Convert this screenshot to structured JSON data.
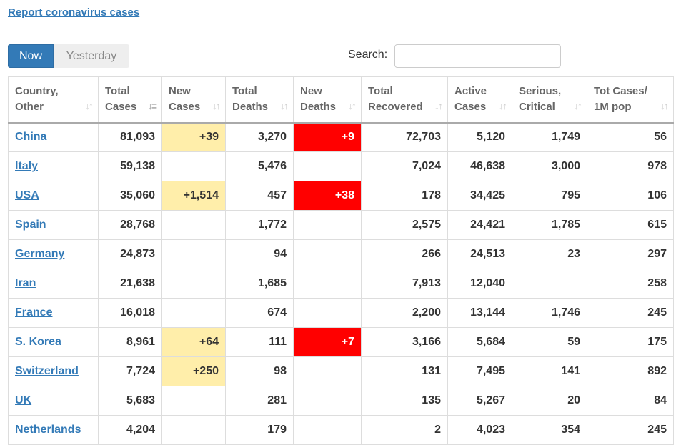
{
  "report_link": "Report coronavirus cases",
  "tabs": {
    "now": "Now",
    "yesterday": "Yesterday"
  },
  "search": {
    "label": "Search:",
    "value": ""
  },
  "colors": {
    "link": "#337ab7",
    "new_cases_highlight": "#ffeeaa",
    "new_deaths_highlight": "#ff0000"
  },
  "icons": {
    "sort_inactive": "sort-icon",
    "sort_active": "sort-desc-icon"
  },
  "columns": [
    {
      "line1": "Country,",
      "line2": "Other"
    },
    {
      "line1": "Total",
      "line2": "Cases"
    },
    {
      "line1": "New",
      "line2": "Cases"
    },
    {
      "line1": "Total",
      "line2": "Deaths"
    },
    {
      "line1": "New",
      "line2": "Deaths"
    },
    {
      "line1": "Total",
      "line2": "Recovered"
    },
    {
      "line1": "Active",
      "line2": "Cases"
    },
    {
      "line1": "Serious,",
      "line2": "Critical"
    },
    {
      "line1": "Tot Cases/",
      "line2": "1M pop"
    }
  ],
  "rows": [
    {
      "country": "China",
      "total_cases": "81,093",
      "new_cases": "+39",
      "total_deaths": "3,270",
      "new_deaths": "+9",
      "total_recovered": "72,703",
      "active_cases": "5,120",
      "serious_critical": "1,749",
      "per_million": "56"
    },
    {
      "country": "Italy",
      "total_cases": "59,138",
      "new_cases": "",
      "total_deaths": "5,476",
      "new_deaths": "",
      "total_recovered": "7,024",
      "active_cases": "46,638",
      "serious_critical": "3,000",
      "per_million": "978"
    },
    {
      "country": "USA",
      "total_cases": "35,060",
      "new_cases": "+1,514",
      "total_deaths": "457",
      "new_deaths": "+38",
      "total_recovered": "178",
      "active_cases": "34,425",
      "serious_critical": "795",
      "per_million": "106"
    },
    {
      "country": "Spain",
      "total_cases": "28,768",
      "new_cases": "",
      "total_deaths": "1,772",
      "new_deaths": "",
      "total_recovered": "2,575",
      "active_cases": "24,421",
      "serious_critical": "1,785",
      "per_million": "615"
    },
    {
      "country": "Germany",
      "total_cases": "24,873",
      "new_cases": "",
      "total_deaths": "94",
      "new_deaths": "",
      "total_recovered": "266",
      "active_cases": "24,513",
      "serious_critical": "23",
      "per_million": "297"
    },
    {
      "country": "Iran",
      "total_cases": "21,638",
      "new_cases": "",
      "total_deaths": "1,685",
      "new_deaths": "",
      "total_recovered": "7,913",
      "active_cases": "12,040",
      "serious_critical": "",
      "per_million": "258"
    },
    {
      "country": "France",
      "total_cases": "16,018",
      "new_cases": "",
      "total_deaths": "674",
      "new_deaths": "",
      "total_recovered": "2,200",
      "active_cases": "13,144",
      "serious_critical": "1,746",
      "per_million": "245"
    },
    {
      "country": "S. Korea",
      "total_cases": "8,961",
      "new_cases": "+64",
      "total_deaths": "111",
      "new_deaths": "+7",
      "total_recovered": "3,166",
      "active_cases": "5,684",
      "serious_critical": "59",
      "per_million": "175"
    },
    {
      "country": "Switzerland",
      "total_cases": "7,724",
      "new_cases": "+250",
      "total_deaths": "98",
      "new_deaths": "",
      "total_recovered": "131",
      "active_cases": "7,495",
      "serious_critical": "141",
      "per_million": "892"
    },
    {
      "country": "UK",
      "total_cases": "5,683",
      "new_cases": "",
      "total_deaths": "281",
      "new_deaths": "",
      "total_recovered": "135",
      "active_cases": "5,267",
      "serious_critical": "20",
      "per_million": "84"
    },
    {
      "country": "Netherlands",
      "total_cases": "4,204",
      "new_cases": "",
      "total_deaths": "179",
      "new_deaths": "",
      "total_recovered": "2",
      "active_cases": "4,023",
      "serious_critical": "354",
      "per_million": "245"
    }
  ]
}
